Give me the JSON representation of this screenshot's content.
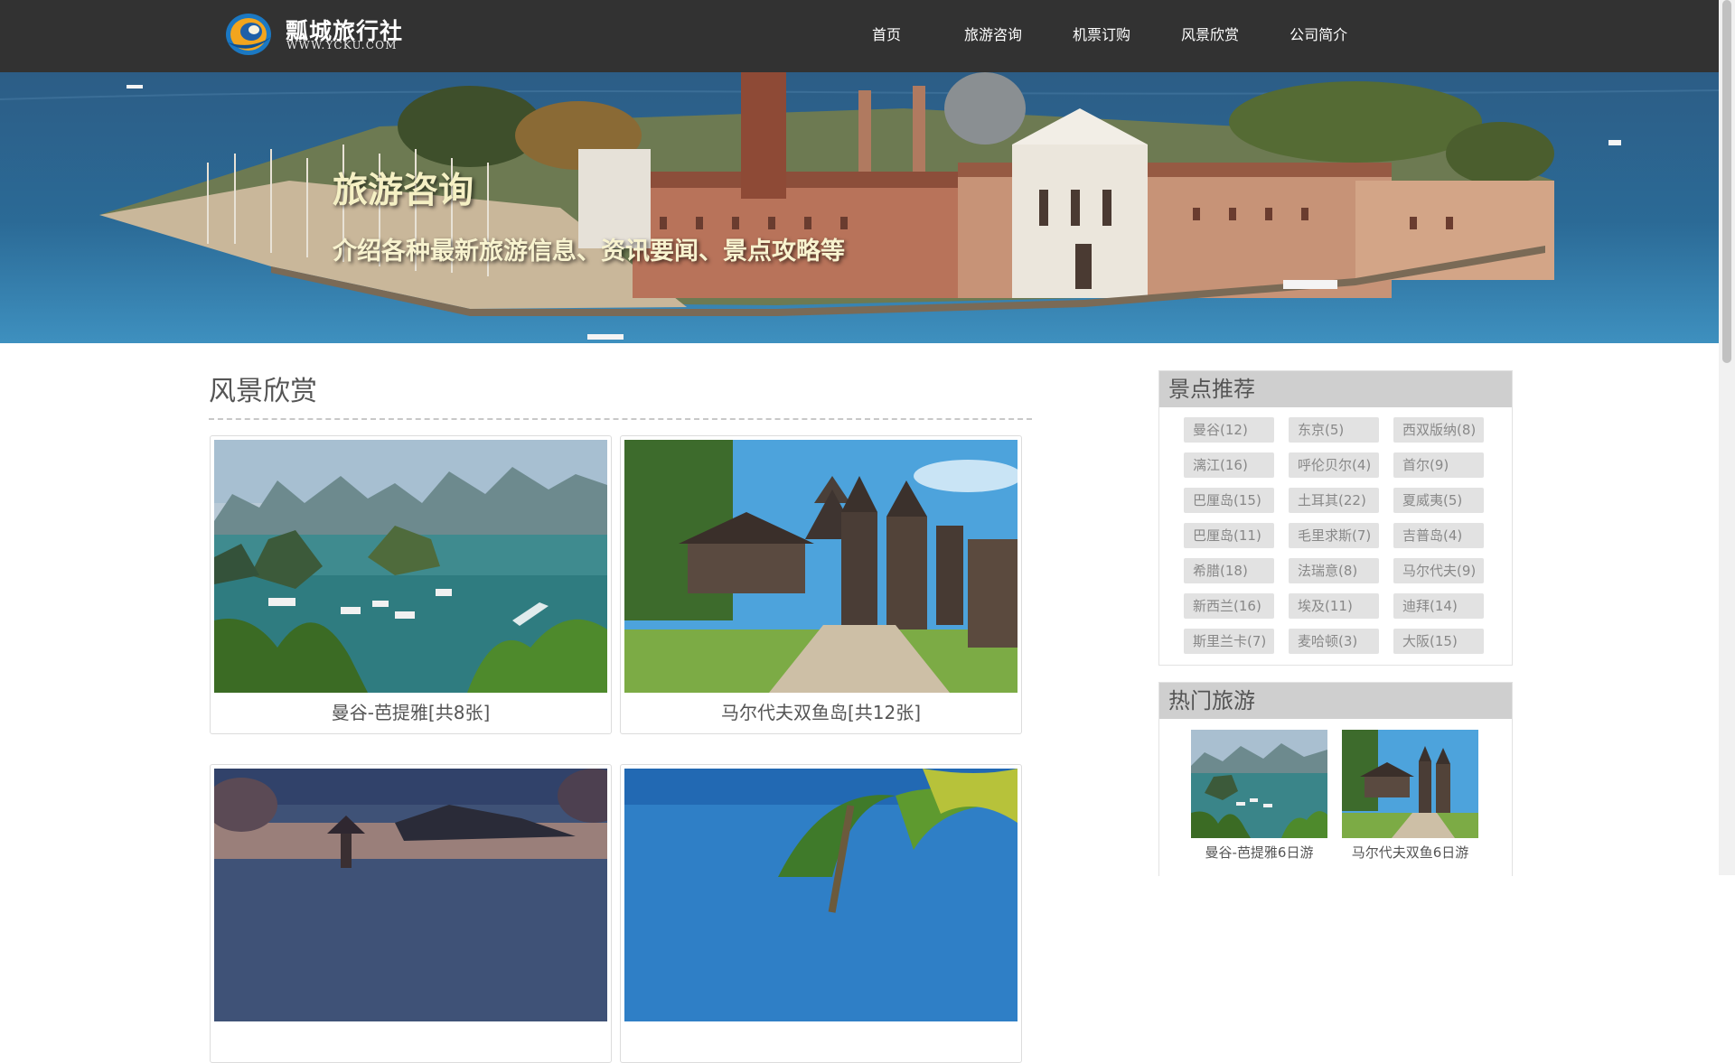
{
  "header": {
    "logo_title": "瓢城旅行社",
    "logo_subtitle": "WWW.YCKU.COM",
    "nav": [
      {
        "label": "首页"
      },
      {
        "label": "旅游咨询"
      },
      {
        "label": "机票订购"
      },
      {
        "label": "风景欣赏"
      },
      {
        "label": "公司简介"
      }
    ]
  },
  "banner": {
    "title": "旅游咨询",
    "subtitle": "介绍各种最新旅游信息、资讯要闻、景点攻略等"
  },
  "main": {
    "section_title": "风景欣赏",
    "cards": [
      {
        "caption": "曼谷-芭提雅[共8张]"
      },
      {
        "caption": "马尔代夫双鱼岛[共12张]"
      },
      {
        "caption": ""
      },
      {
        "caption": ""
      }
    ]
  },
  "sidebar": {
    "recommend_title": "景点推荐",
    "tags": [
      "曼谷(12)",
      "东京(5)",
      "西双版纳(8)",
      "漓江(16)",
      "呼伦贝尔(4)",
      "首尔(9)",
      "巴厘岛(15)",
      "土耳其(22)",
      "夏威夷(5)",
      "巴厘岛(11)",
      "毛里求斯(7)",
      "吉普岛(4)",
      "希腊(18)",
      "法瑞意(8)",
      "马尔代夫(9)",
      "新西兰(16)",
      "埃及(11)",
      "迪拜(14)",
      "斯里兰卡(7)",
      "麦哈顿(3)",
      "大阪(15)"
    ],
    "hot_title": "热门旅游",
    "hot_items": [
      {
        "caption": "曼谷-芭提雅6日游"
      },
      {
        "caption": "马尔代夫双鱼6日游"
      }
    ]
  },
  "colors": {
    "header_bg": "#323232",
    "panel_head_bg": "#cfcfcf",
    "tag_bg": "#e2e2e2",
    "banner_text": "#f5f0c4"
  }
}
